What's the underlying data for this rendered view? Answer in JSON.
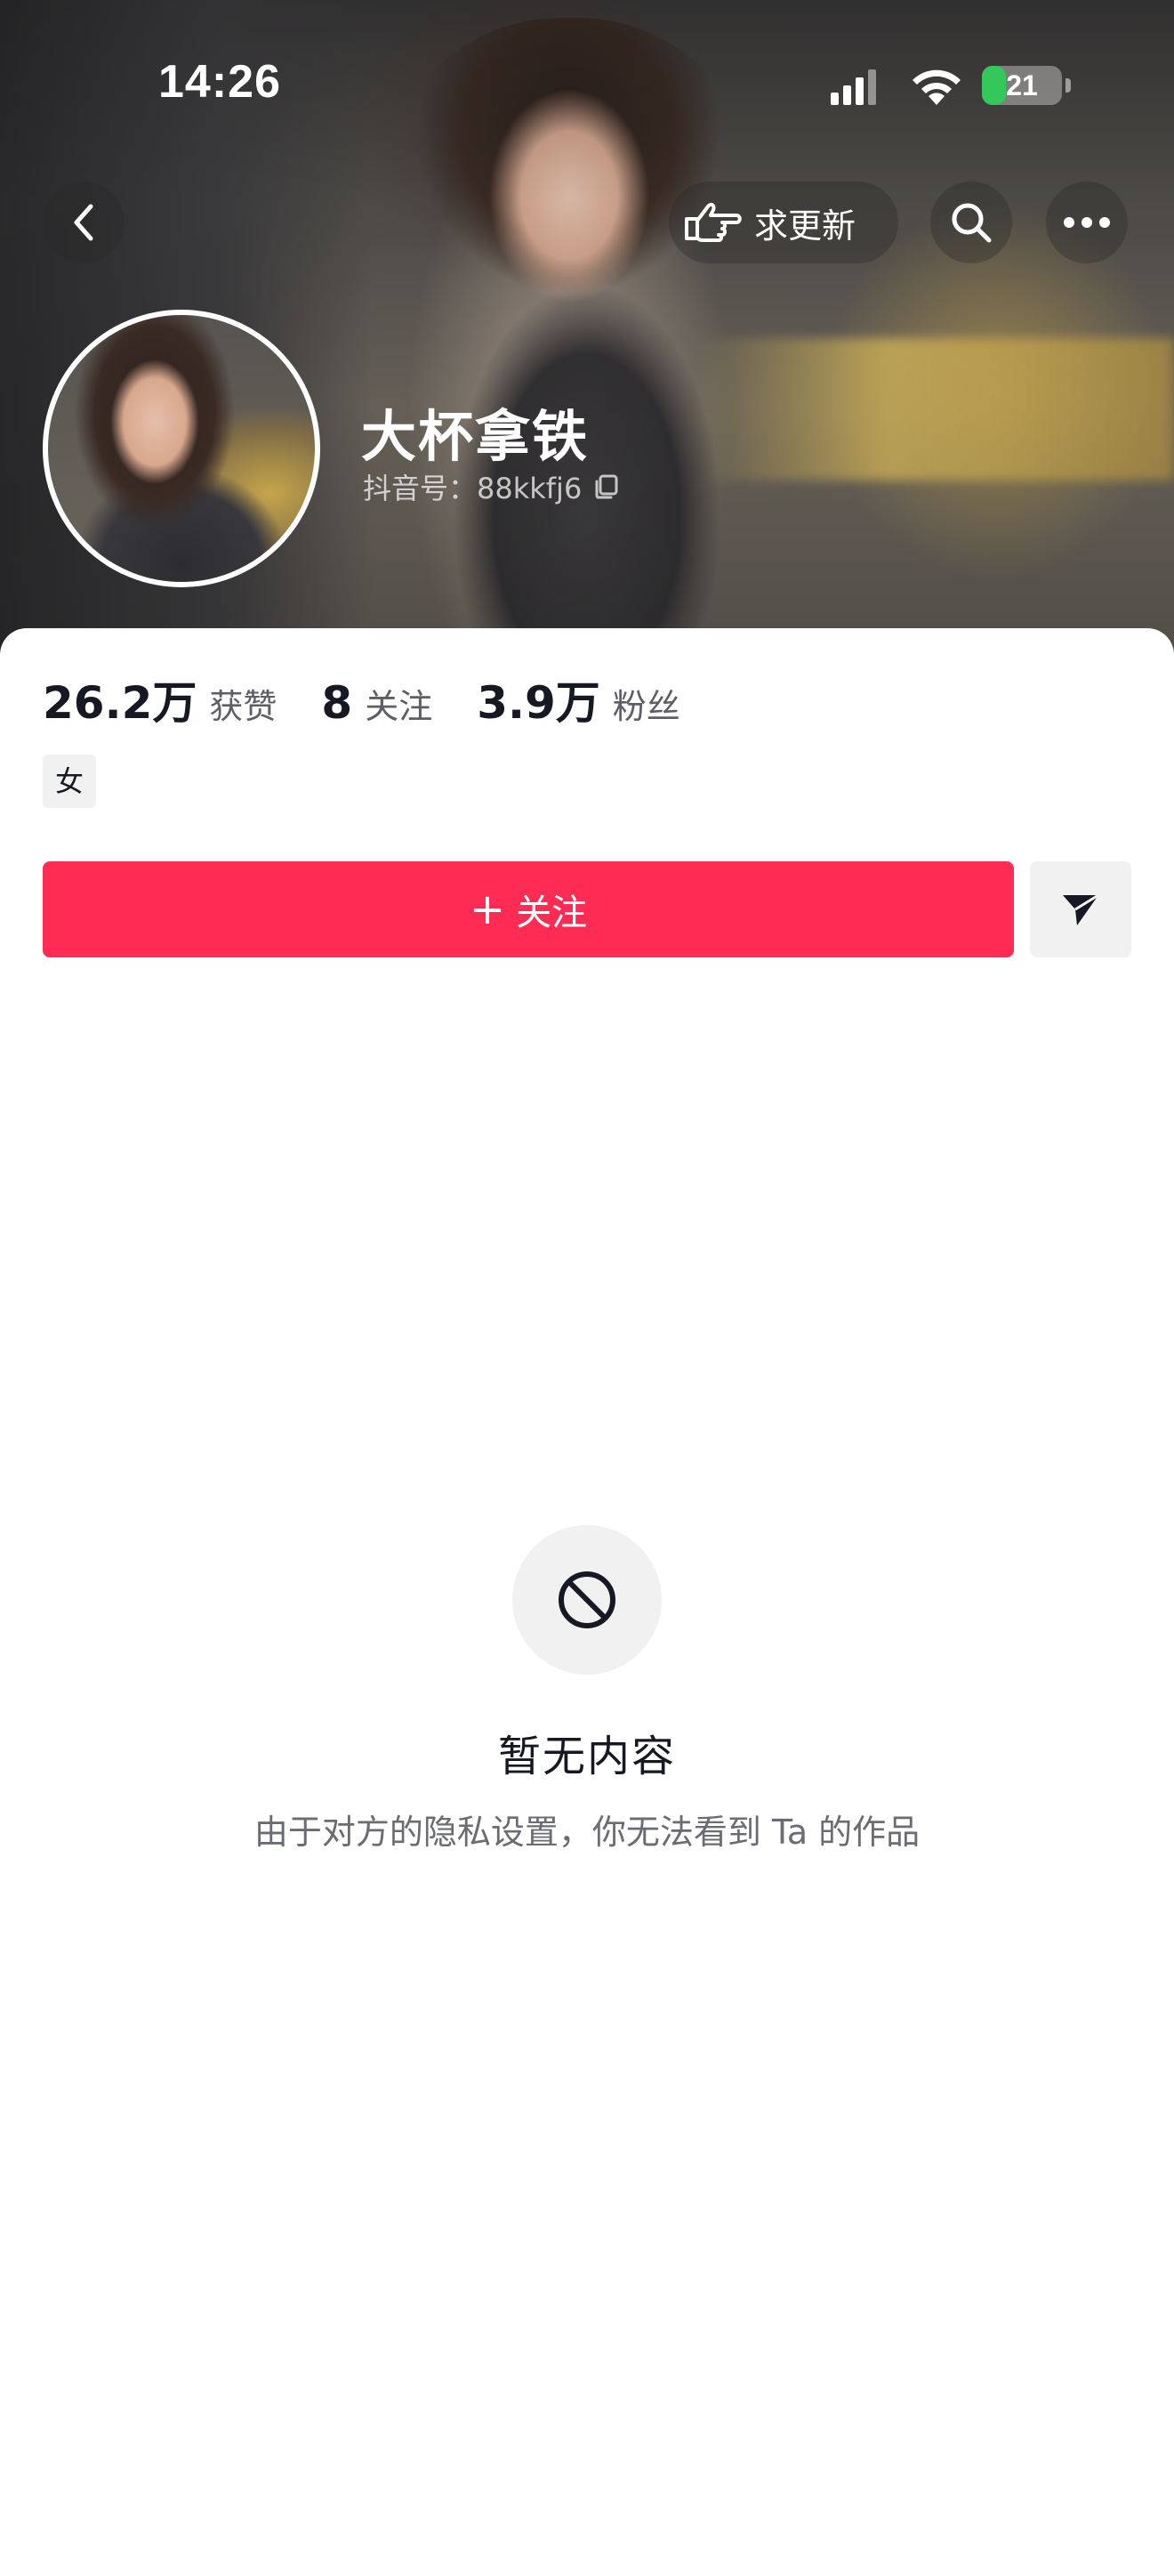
{
  "status_bar": {
    "time": "14:26",
    "battery_level": "21",
    "battery_color": "#34c759"
  },
  "nav": {
    "back_icon": "chevron-left-icon",
    "update_label": "求更新",
    "update_icon": "pointing-hand-icon",
    "search_icon": "search-icon",
    "more_icon": "more-dots-icon"
  },
  "profile": {
    "nickname": "大杯拿铁",
    "account_id": "抖音号：88kkfj6",
    "copy_icon": "copy-icon"
  },
  "stats": [
    {
      "value": "26.2万",
      "label": "获赞"
    },
    {
      "value": "8",
      "label": "关注"
    },
    {
      "value": "3.9万",
      "label": "粉丝"
    }
  ],
  "tags": {
    "gender": "女"
  },
  "actions": {
    "follow_label": "关注",
    "follow_color": "#fe2c55",
    "message_icon": "send-icon"
  },
  "empty_state": {
    "icon": "prohibited-icon",
    "title": "暂无内容",
    "description": "由于对方的隐私设置，你无法看到 Ta 的作品"
  }
}
